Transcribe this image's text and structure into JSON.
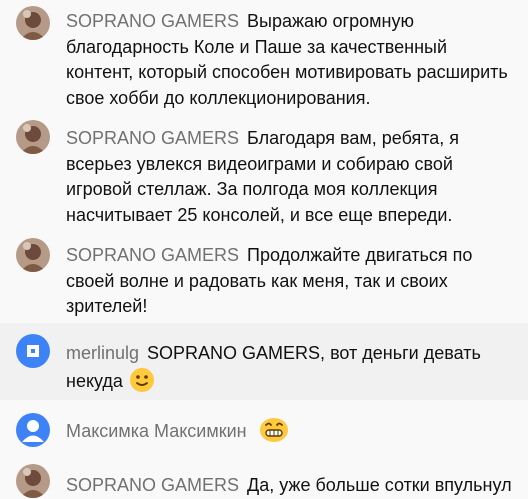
{
  "messages": [
    {
      "author": "SOPRANO GAMERS",
      "text": "Выражаю огромную благодарность Коле и Паше за качественный контент, который способен мотивировать расширить свое хобби до коллекционирования.",
      "avatar": "soprano-gamers-avatar"
    },
    {
      "author": "SOPRANO GAMERS",
      "text": "Благодаря вам, ребята, я всерьез увлекся видеоиграми и собираю свой игровой стеллаж. За полгода моя коллекция насчитывает 25 консолей, и все еще впереди.",
      "avatar": "soprano-gamers-avatar"
    },
    {
      "author": "SOPRANO GAMERS",
      "text": "Продолжайте двигаться по своей волне и радовать как меня, так и своих зрителей!",
      "avatar": "soprano-gamers-avatar"
    },
    {
      "author": "merlinulg",
      "text": "SOPRANO GAMERS, вот деньги девать некуда",
      "emoji": "slightly-smiling-face-emoji",
      "avatar": "default-pattern-avatar"
    },
    {
      "author": "Максимка Максимкин",
      "text": "",
      "emoji": "grinning-face-emoji",
      "avatar": "default-person-avatar"
    },
    {
      "author": "SOPRANO GAMERS",
      "text": "Да, уже больше сотки впульнул",
      "avatar": "soprano-gamers-avatar"
    }
  ],
  "colors": {
    "background": "#f9f9f9",
    "alt_background": "#f1f1f1",
    "author": "#717171",
    "text": "#111111",
    "avatar_blue": "#3e82f7",
    "emoji_yellow": "#ffc83d"
  }
}
